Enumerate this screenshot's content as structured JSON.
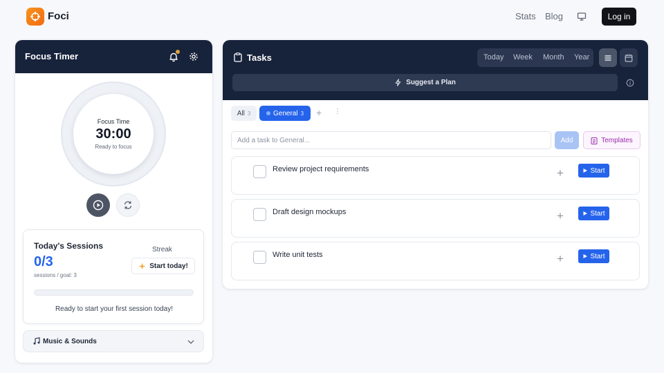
{
  "header": {
    "brand": "Foci",
    "nav": [
      "Stats",
      "Blog"
    ],
    "login_label": "Log in",
    "icons": {
      "logo": "crosshair-icon",
      "display": "monitor-icon"
    }
  },
  "focus": {
    "title": "Focus Timer",
    "timer_label": "Focus Time",
    "time": "30:00",
    "status": "Ready to focus",
    "sessions": {
      "title": "Today's Sessions",
      "count": "0/3",
      "goal_text": "sessions / goal: 3",
      "streak_label": "Streak",
      "streak_button": "Start today!",
      "progress": 0,
      "message": "Ready to start your first session today!"
    },
    "music_label": "Music & Sounds"
  },
  "tasks": {
    "title": "Tasks",
    "ranges": [
      "Today",
      "Week",
      "Month",
      "Year"
    ],
    "suggest_label": "Suggest a Plan",
    "tabs": [
      {
        "label": "All",
        "count": "3"
      },
      {
        "label": "General",
        "count": "3"
      }
    ],
    "input_placeholder": "Add a task to General...",
    "add_label": "Add",
    "templates_label": "Templates",
    "start_label": "Start",
    "items": [
      {
        "title": "Review project requirements"
      },
      {
        "title": "Draft design mockups"
      },
      {
        "title": "Write unit tests"
      }
    ]
  },
  "colors": {
    "accent": "#2563eb",
    "header_bg": "#17223b",
    "brand_orange": "#f26b0f"
  }
}
